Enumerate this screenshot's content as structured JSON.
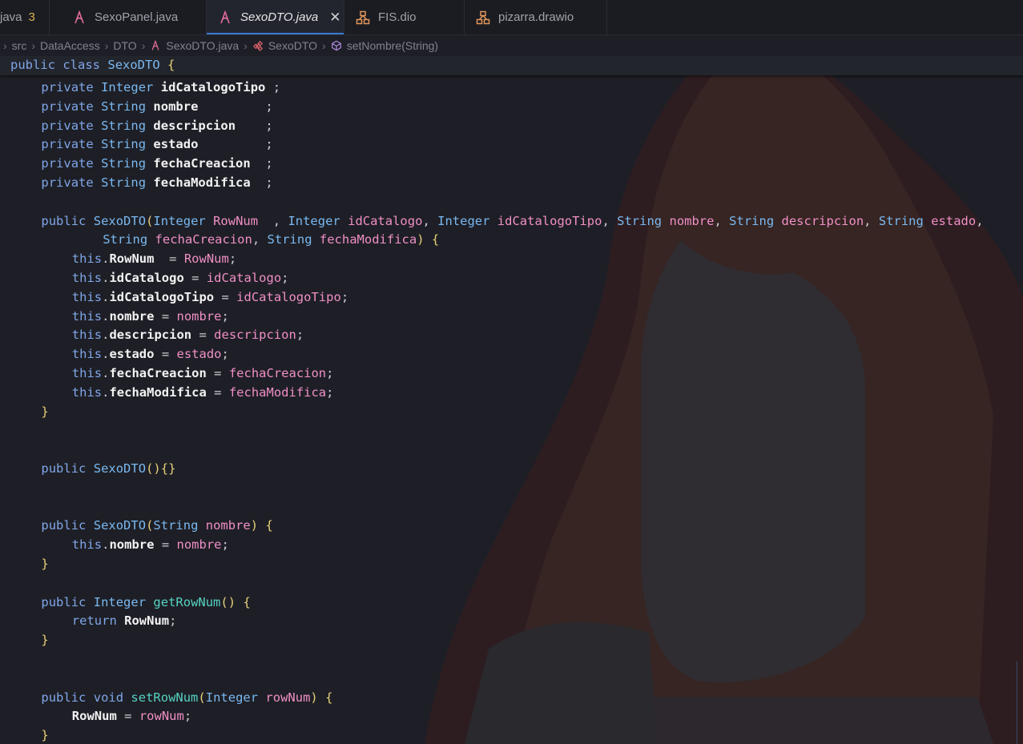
{
  "tabs": [
    {
      "label": "java",
      "badge": "3"
    },
    {
      "label": "SexoPanel.java",
      "icon": "java-icon"
    },
    {
      "label": "SexoDTO.java",
      "icon": "java-icon",
      "active": true,
      "close": "✕"
    },
    {
      "label": "FIS.dio",
      "icon": "drawio-icon"
    },
    {
      "label": "pizarra.drawio",
      "icon": "drawio-icon"
    }
  ],
  "breadcrumb": {
    "items": [
      "src",
      "DataAccess",
      "DTO",
      "SexoDTO.java",
      "SexoDTO",
      "setNombre(String)"
    ],
    "separator": "›"
  },
  "editor": {
    "sticky_line": "public class SexoDTO {",
    "lines": [
      "    private Integer idCatalogoTipo ;",
      "    private String nombre         ;",
      "    private String descripcion    ;",
      "    private String estado         ;",
      "    private String fechaCreacion  ;",
      "    private String fechaModifica  ;",
      "",
      "    public SexoDTO(Integer RowNum  , Integer idCatalogo, Integer idCatalogoTipo, String nombre, String descripcion, String estado,",
      "            String fechaCreacion, String fechaModifica) {",
      "        this.RowNum  = RowNum;",
      "        this.idCatalogo = idCatalogo;",
      "        this.idCatalogoTipo = idCatalogoTipo;",
      "        this.nombre = nombre;",
      "        this.descripcion = descripcion;",
      "        this.estado = estado;",
      "        this.fechaCreacion = fechaCreacion;",
      "        this.fechaModifica = fechaModifica;",
      "    }",
      "",
      "",
      "    public SexoDTO(){}",
      "",
      "",
      "    public SexoDTO(String nombre) {",
      "        this.nombre = nombre;",
      "    }",
      "",
      "    public Integer getRowNum() {",
      "        return RowNum;",
      "    }",
      "",
      "",
      "    public void setRowNum(Integer rowNum) {",
      "        RowNum = rowNum;",
      "    }"
    ]
  },
  "colors": {
    "background": "#1e1f26",
    "keyword": "#7fa6e8",
    "type": "#7ab8f0",
    "field": "#f2f2f2",
    "parameter": "#f08fc6",
    "function": "#55d1c3",
    "bracket": "#e8d07a",
    "active_tab_underline": "#3a7bd5",
    "problem_badge": "#d9b24c"
  }
}
